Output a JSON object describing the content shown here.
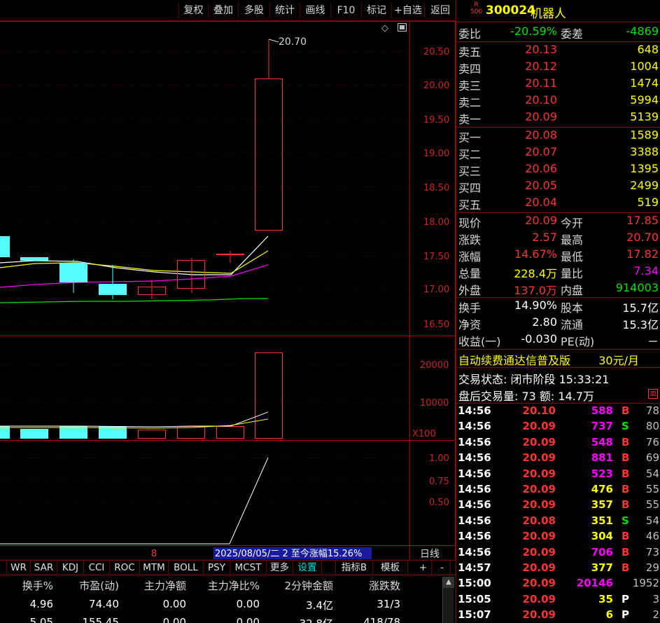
{
  "toolbar": {
    "buttons": [
      "复权",
      "叠加",
      "多股",
      "统计",
      "画线",
      "F10",
      "标记",
      "+自选",
      "返回"
    ]
  },
  "chart": {
    "price_axis": [
      "20.50",
      "20.00",
      "19.50",
      "19.00",
      "18.50",
      "18.00",
      "17.50",
      "17.00",
      "16.50"
    ],
    "high_label": "20.70",
    "volume_axis": [
      "20000",
      "10000"
    ],
    "volume_unit": "X100",
    "indicator_axis": [
      "1.00",
      "0.75",
      "0.50"
    ],
    "bottom_left_marker": "8",
    "status_text": "2025/08/05/二 2 至今涨幅15.26%",
    "period_label": "日线",
    "colors": {
      "up": "#ff3232",
      "down": "#54ffff",
      "ma5": "#ffffff",
      "ma10": "#ffff00",
      "ma20": "#ff00ff",
      "ma60": "#00e600"
    }
  },
  "tabs": [
    "WR",
    "SAR",
    "KDJ",
    "CCI",
    "ROC",
    "MTM",
    "BOLL",
    "PSY",
    "MCST",
    "更多",
    "设置",
    "指标B",
    "模板",
    "+",
    "-"
  ],
  "table": {
    "headers": [
      "换手%",
      "市盈(动)",
      "主力净额",
      "主力净比%",
      "2分钟金额",
      "涨跌数"
    ],
    "rows": [
      [
        "4.96",
        "74.40",
        "0.00",
        "0.00",
        "3.4亿",
        "31/3"
      ],
      [
        "5.05",
        "155.45",
        "0.00",
        "0.00",
        "32.8亿",
        "418/78"
      ]
    ]
  },
  "panel": {
    "badge_top": "R",
    "badge_bottom": "500",
    "code": "300024",
    "name": "机器人",
    "weibi_label": "委比",
    "weibi": "-20.59%",
    "weicha_label": "委差",
    "weicha": "-4869",
    "asks": [
      {
        "label": "卖五",
        "price": "20.13",
        "vol": "648"
      },
      {
        "label": "卖四",
        "price": "20.12",
        "vol": "1004"
      },
      {
        "label": "卖三",
        "price": "20.11",
        "vol": "1474"
      },
      {
        "label": "卖二",
        "price": "20.10",
        "vol": "5994"
      },
      {
        "label": "卖一",
        "price": "20.09",
        "vol": "5139"
      }
    ],
    "bids": [
      {
        "label": "买一",
        "price": "20.08",
        "vol": "1589"
      },
      {
        "label": "买二",
        "price": "20.07",
        "vol": "3388"
      },
      {
        "label": "买三",
        "price": "20.06",
        "vol": "1395"
      },
      {
        "label": "买四",
        "price": "20.05",
        "vol": "2499"
      },
      {
        "label": "买五",
        "price": "20.04",
        "vol": "519"
      }
    ],
    "quote": [
      {
        "l1": "现价",
        "v1": "20.09",
        "c1": "red",
        "l2": "今开",
        "v2": "17.85",
        "c2": "red"
      },
      {
        "l1": "涨跌",
        "v1": "2.57",
        "c1": "red",
        "l2": "最高",
        "v2": "20.70",
        "c2": "red"
      },
      {
        "l1": "涨幅",
        "v1": "14.67%",
        "c1": "red",
        "l2": "最低",
        "v2": "17.82",
        "c2": "red"
      },
      {
        "l1": "总量",
        "v1": "228.4万",
        "c1": "yellow",
        "l2": "量比",
        "v2": "7.34",
        "c2": "magenta"
      },
      {
        "l1": "外盘",
        "v1": "137.0万",
        "c1": "red",
        "l2": "内盘",
        "v2": "914003",
        "c2": "green"
      }
    ],
    "fundamentals": [
      {
        "l1": "换手",
        "v1": "14.90%",
        "l2": "股本",
        "v2": "15.7亿"
      },
      {
        "l1": "净资",
        "v1": "2.80",
        "l2": "流通",
        "v2": "15.3亿"
      },
      {
        "l1": "收益(一)",
        "v1": "-0.030",
        "l2": "PE(动)",
        "v2": "－"
      }
    ],
    "promo": "自动续费通达信普及版",
    "promo_price": "30元/月",
    "trade_status": "交易状态: 闭市阶段 15:33:21",
    "after_hours": "盘后交易量: 73  额: 14.7万",
    "ticks": [
      {
        "time": "14:56",
        "price": "20.10",
        "vol": "588",
        "vc": "magenta",
        "side": "B",
        "n": "78"
      },
      {
        "time": "14:56",
        "price": "20.09",
        "vol": "737",
        "vc": "magenta",
        "side": "S",
        "n": "80"
      },
      {
        "time": "14:56",
        "price": "20.09",
        "vol": "548",
        "vc": "magenta",
        "side": "B",
        "n": "76"
      },
      {
        "time": "14:56",
        "price": "20.09",
        "vol": "881",
        "vc": "magenta",
        "side": "B",
        "n": "69"
      },
      {
        "time": "14:56",
        "price": "20.09",
        "vol": "523",
        "vc": "magenta",
        "side": "B",
        "n": "54"
      },
      {
        "time": "14:56",
        "price": "20.09",
        "vol": "476",
        "vc": "yellow",
        "side": "B",
        "n": "55"
      },
      {
        "time": "14:56",
        "price": "20.09",
        "vol": "357",
        "vc": "yellow",
        "side": "B",
        "n": "55"
      },
      {
        "time": "14:56",
        "price": "20.08",
        "vol": "351",
        "vc": "yellow",
        "side": "S",
        "n": "54"
      },
      {
        "time": "14:56",
        "price": "20.09",
        "vol": "304",
        "vc": "yellow",
        "side": "B",
        "n": "46"
      },
      {
        "time": "14:56",
        "price": "20.09",
        "vol": "706",
        "vc": "magenta",
        "side": "B",
        "n": "73"
      },
      {
        "time": "14:57",
        "price": "20.09",
        "vol": "377",
        "vc": "yellow",
        "side": "B",
        "n": "29"
      },
      {
        "time": "15:00",
        "price": "20.09",
        "vol": "20146",
        "vc": "magenta",
        "side": "",
        "n": "1952"
      },
      {
        "time": "15:05",
        "price": "20.09",
        "vol": "35",
        "vc": "yellow",
        "side": "P",
        "n": "3"
      },
      {
        "time": "15:07",
        "price": "20.09",
        "vol": "6",
        "vc": "yellow",
        "side": "P",
        "n": "2"
      }
    ]
  }
}
